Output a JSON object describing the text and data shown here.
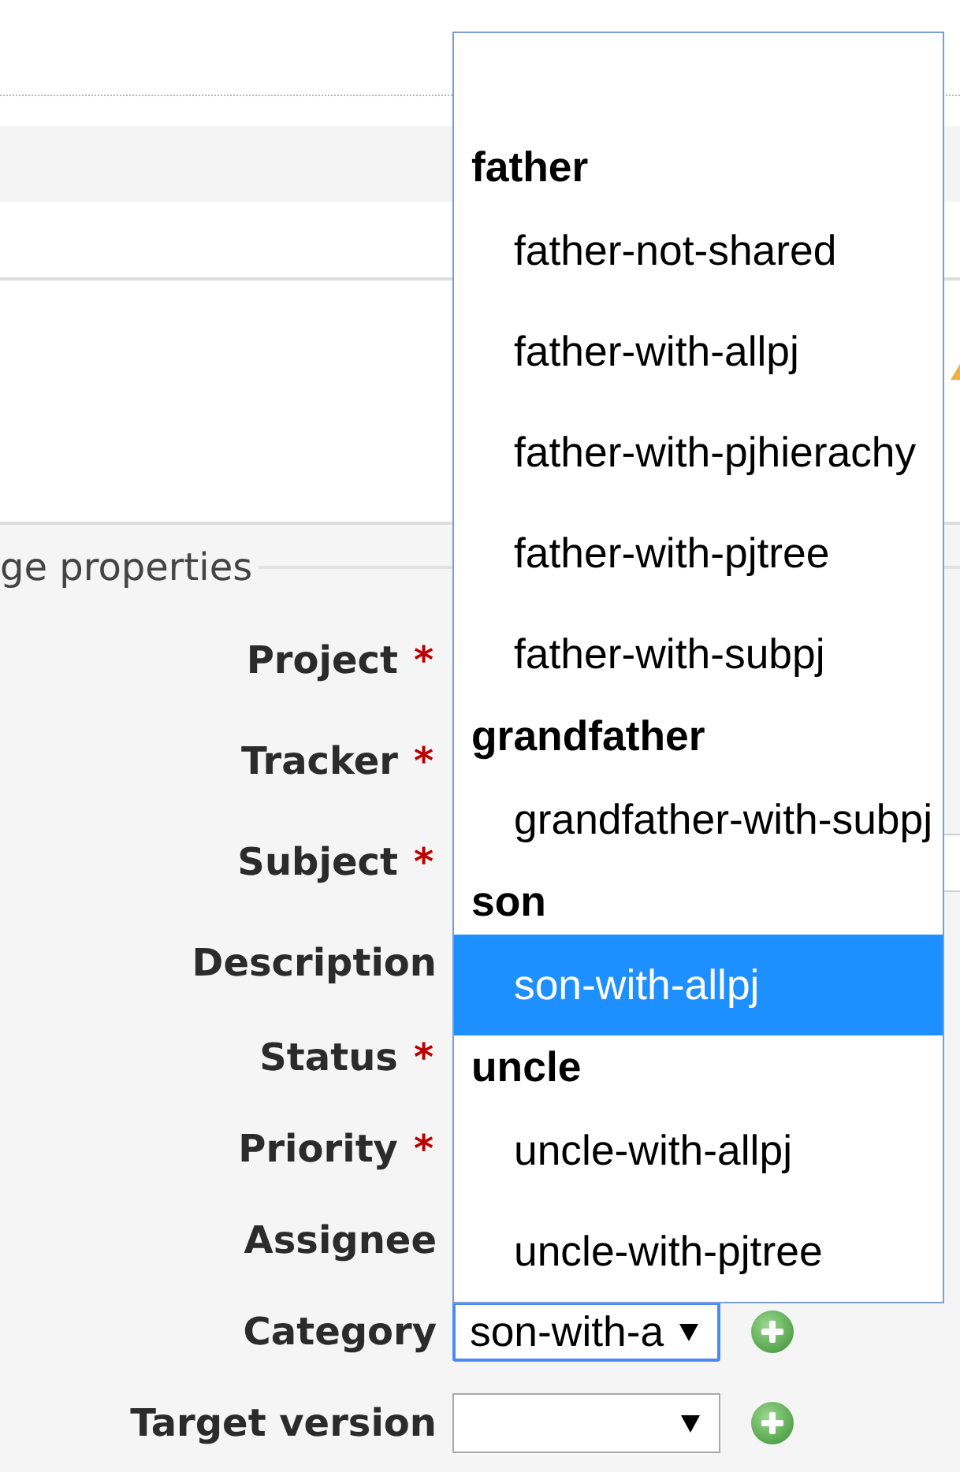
{
  "form": {
    "legend": "ge properties",
    "fields": [
      {
        "label": "Project",
        "required_mark": "*"
      },
      {
        "label": "Tracker",
        "required_mark": "*"
      },
      {
        "label": "Subject",
        "required_mark": "*",
        "control": {
          "kind": "text"
        }
      },
      {
        "label": "Description"
      },
      {
        "label": "Status",
        "required_mark": "*"
      },
      {
        "label": "Priority",
        "required_mark": "*"
      },
      {
        "label": "Assignee"
      },
      {
        "label": "Category",
        "control": {
          "kind": "select",
          "value": "son-with-a",
          "focused": true,
          "add_button": true
        }
      },
      {
        "label": "Target version",
        "control": {
          "kind": "select",
          "focused": false,
          "add_button": true
        }
      }
    ]
  },
  "category_dropdown": {
    "groups": [
      {
        "label": "father",
        "options": [
          {
            "label": "father-not-shared",
            "selected": false
          },
          {
            "label": "father-with-allpj",
            "selected": false
          },
          {
            "label": "father-with-pjhierachy",
            "selected": false
          },
          {
            "label": "father-with-pjtree",
            "selected": false
          },
          {
            "label": "father-with-subpj",
            "selected": false
          }
        ]
      },
      {
        "label": "grandfather",
        "options": [
          {
            "label": "grandfather-with-subpj",
            "selected": false
          }
        ]
      },
      {
        "label": "son",
        "options": [
          {
            "label": "son-with-allpj",
            "selected": true
          }
        ]
      },
      {
        "label": "uncle",
        "options": [
          {
            "label": "uncle-with-allpj",
            "selected": false
          },
          {
            "label": "uncle-with-pjtree",
            "selected": false
          }
        ]
      }
    ]
  }
}
